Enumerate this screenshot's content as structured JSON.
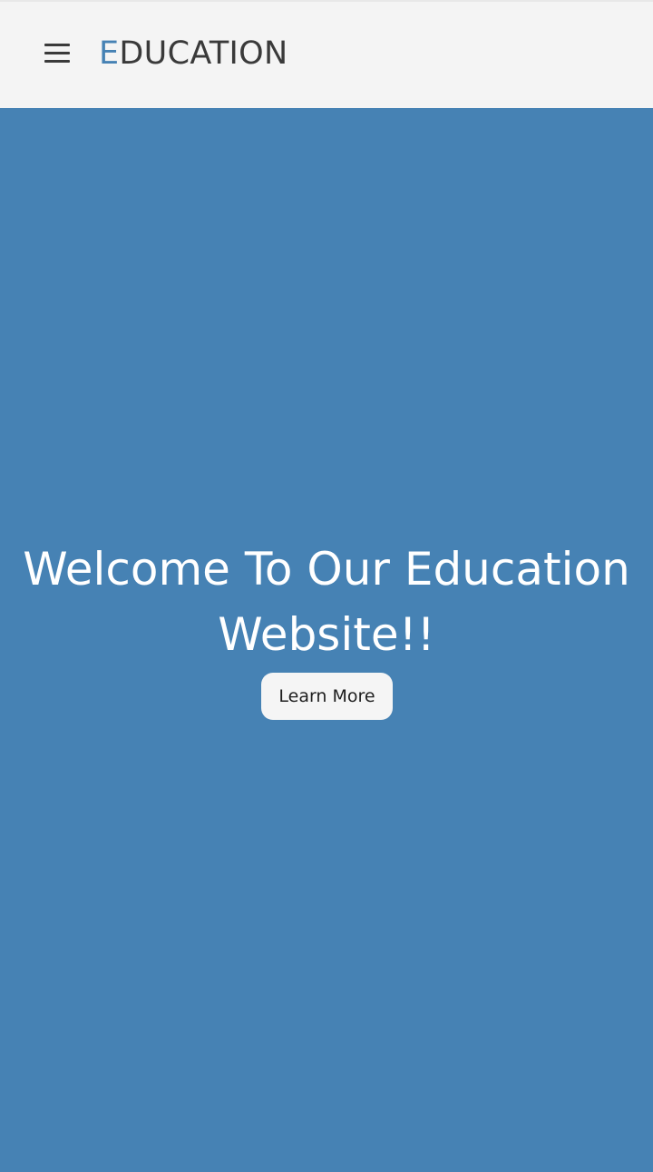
{
  "navbar": {
    "menu_icon": "hamburger-menu-icon",
    "brand_first_letter": "E",
    "brand_rest": "DUCATION"
  },
  "hero": {
    "title": "Welcome To Our Education Website!!",
    "button_label": "Learn More"
  },
  "colors": {
    "hero_background": "#4682b4",
    "navbar_background": "#f4f4f4",
    "brand_accent": "#4682b4",
    "text_dark": "#3a3a3a",
    "button_background": "#f5f5f5"
  }
}
